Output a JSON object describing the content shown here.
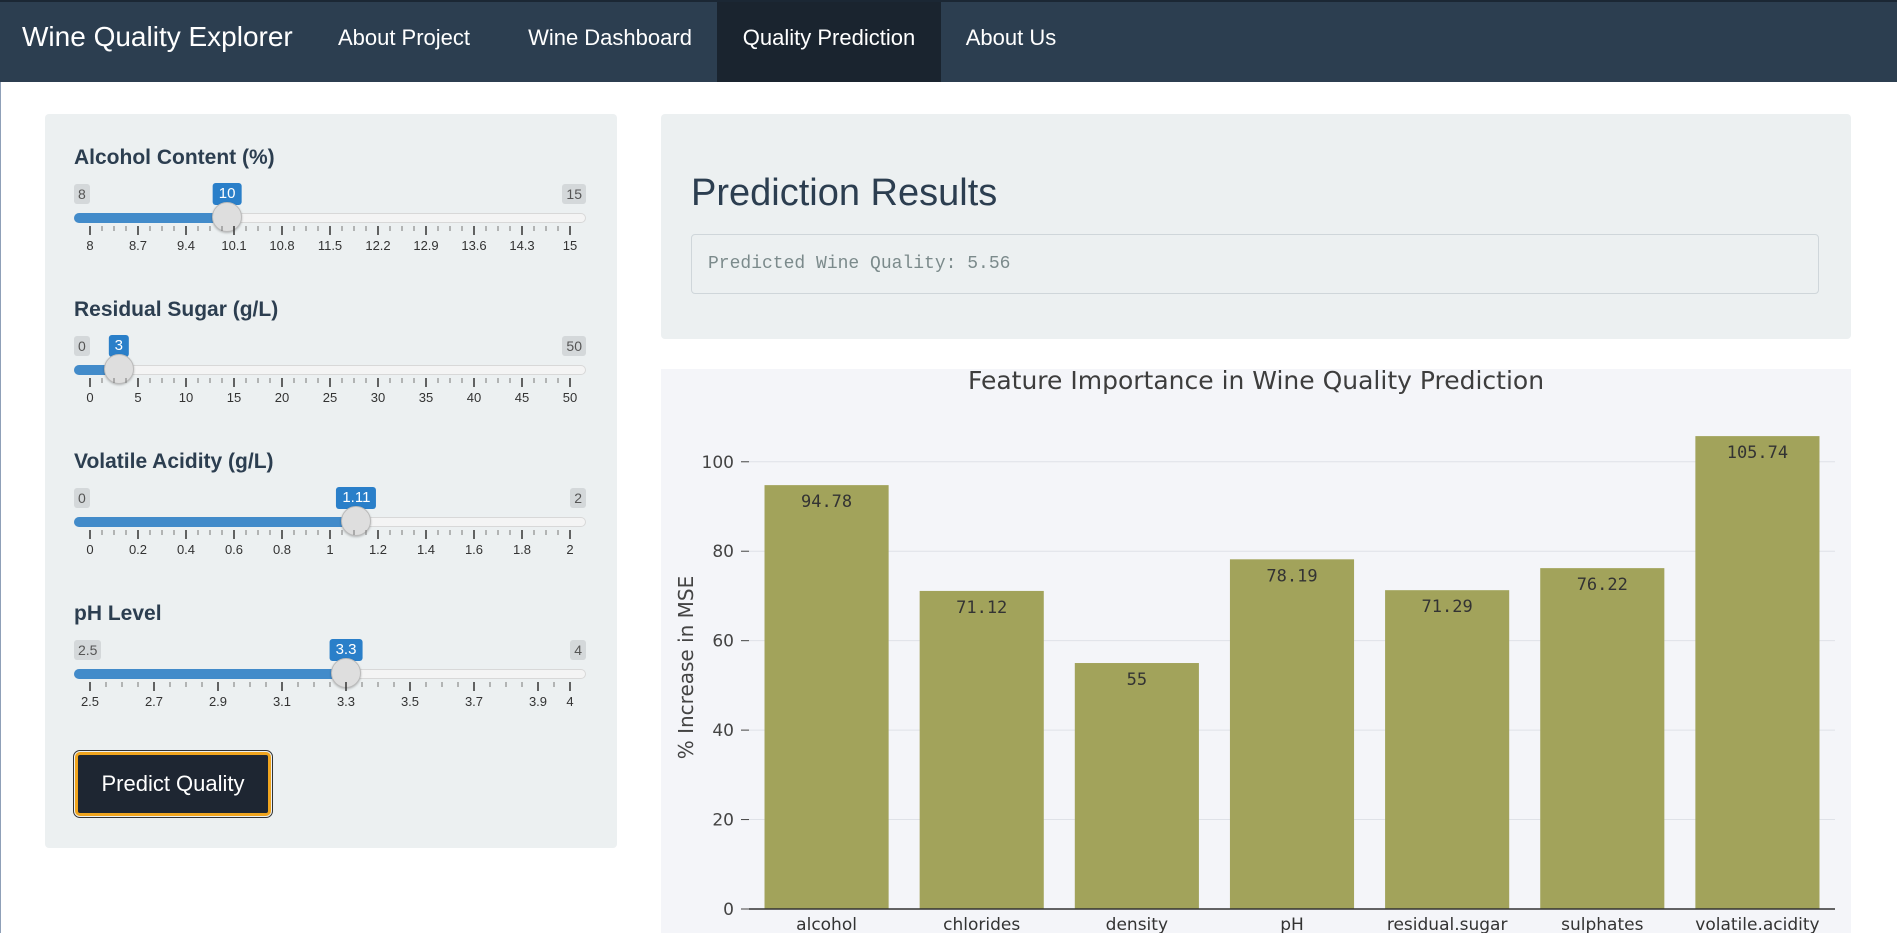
{
  "navbar": {
    "brand": "Wine Quality Explorer",
    "items": [
      "About Project",
      "Wine Dashboard",
      "Quality Prediction",
      "About Us"
    ],
    "active_index": 2
  },
  "sliders": [
    {
      "label": "Alcohol Content (%)",
      "min": 8,
      "max": 15,
      "value": 10,
      "min_label": "8",
      "max_label": "15",
      "value_label": "10",
      "major_ticks": [
        "8",
        "8.7",
        "9.4",
        "10.1",
        "10.8",
        "11.5",
        "12.2",
        "12.9",
        "13.6",
        "14.3",
        "15"
      ]
    },
    {
      "label": "Residual Sugar (g/L)",
      "min": 0,
      "max": 50,
      "value": 3,
      "min_label": "0",
      "max_label": "50",
      "value_label": "3",
      "major_ticks": [
        "0",
        "5",
        "10",
        "15",
        "20",
        "25",
        "30",
        "35",
        "40",
        "45",
        "50"
      ]
    },
    {
      "label": "Volatile Acidity (g/L)",
      "min": 0,
      "max": 2,
      "value": 1.11,
      "min_label": "0",
      "max_label": "2",
      "value_label": "1.11",
      "major_ticks": [
        "0",
        "0.2",
        "0.4",
        "0.6",
        "0.8",
        "1",
        "1.2",
        "1.4",
        "1.6",
        "1.8",
        "2"
      ]
    },
    {
      "label": "pH Level",
      "min": 2.5,
      "max": 4,
      "value": 3.3,
      "min_label": "2.5",
      "max_label": "4",
      "value_label": "3.3",
      "major_ticks": [
        "2.5",
        "2.7",
        "2.9",
        "3.1",
        "3.3",
        "3.5",
        "3.7",
        "3.9",
        "4"
      ]
    }
  ],
  "predict_button": "Predict Quality",
  "results": {
    "title": "Prediction Results",
    "output": "Predicted Wine Quality: 5.56"
  },
  "colors": {
    "navbar": "#2c3e50",
    "slider_accent": "#428bca",
    "bar": "#a2a35b",
    "button_border": "#f0a51f"
  },
  "chart_data": {
    "type": "bar",
    "title": "Feature Importance in Wine Quality Prediction",
    "xlabel": "",
    "ylabel": "% Increase in MSE",
    "categories": [
      "alcohol",
      "chlorides",
      "density",
      "pH",
      "residual.sugar",
      "sulphates",
      "volatile.acidity"
    ],
    "values": [
      94.78,
      71.12,
      55,
      78.19,
      71.29,
      76.22,
      105.74
    ],
    "value_labels": [
      "94.78",
      "71.12",
      "55",
      "78.19",
      "71.29",
      "76.22",
      "105.74"
    ],
    "ylim": [
      0,
      108
    ],
    "yticks": [
      0,
      20,
      40,
      60,
      80,
      100
    ],
    "grid": true
  }
}
